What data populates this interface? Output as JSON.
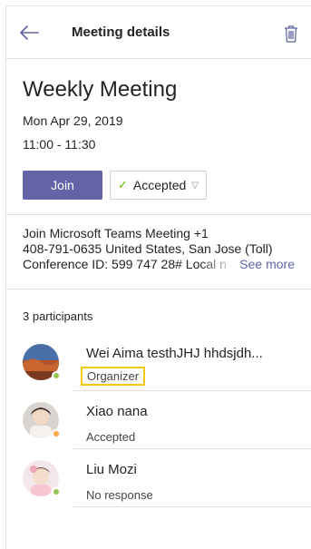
{
  "header": {
    "title": "Meeting details"
  },
  "meeting": {
    "title": "Weekly Meeting",
    "date": "Mon Apr 29, 2019",
    "time": "11:00 - 11:30",
    "join_label": "Join",
    "response_label": "Accepted"
  },
  "dialin": {
    "line1": "Join Microsoft Teams Meeting +1",
    "line2": "408-791-0635 United States, San Jose (Toll)",
    "line3": "Conference ID: 599 747 28# Local n",
    "see_more": "See more"
  },
  "participants": {
    "count_label": "3 participants",
    "items": [
      {
        "name": "Wei Aima testhJHJ hhdsjdh...",
        "status": "Organizer",
        "presence_color": "#92c353"
      },
      {
        "name": "Xiao nana",
        "status": "Accepted",
        "presence_color": "#f8a542"
      },
      {
        "name": "Liu Mozi",
        "status": "No response",
        "presence_color": "#92c353"
      }
    ]
  },
  "colors": {
    "accent": "#6264a7",
    "organizer_highlight": "#f2c811",
    "check": "#6bb700"
  },
  "icons": {
    "back": "arrow-left-icon",
    "trash": "trash-icon",
    "check": "check-icon",
    "chevron": "chevron-down-icon"
  }
}
